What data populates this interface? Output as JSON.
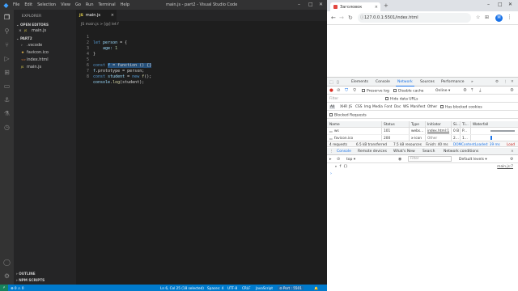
{
  "vscode": {
    "menu": [
      "File",
      "Edit",
      "Selection",
      "View",
      "Go",
      "Run",
      "Terminal",
      "Help"
    ],
    "window_title": "main.js - part2 - Visual Studio Code",
    "sidebar": {
      "title": "EXPLORER",
      "open_editors_label": "OPEN EDITORS",
      "open_editors": [
        {
          "close": "×",
          "icon": "JS",
          "name": "main.js"
        }
      ],
      "folder_label": "PART2",
      "files": [
        {
          "icon": "›",
          "name": ".vscode"
        },
        {
          "icon": "★",
          "name": "favicon.ico"
        },
        {
          "icon": "<>",
          "name": "index.html"
        },
        {
          "icon": "JS",
          "name": "main.js"
        }
      ],
      "outline_label": "OUTLINE",
      "npm_label": "NPM SCRIPTS"
    },
    "tab": {
      "icon": "JS",
      "name": "main.js",
      "close": "×"
    },
    "breadcrumb": "JS main.js > [@] let f",
    "code": {
      "numbers": [
        "1",
        "2",
        "3",
        "4",
        "5",
        "6",
        "7",
        "8"
      ],
      "l1": {
        "kw": "let ",
        "var": "person",
        "rest": " = {"
      },
      "l2": {
        "text": "    age: ",
        "num": "1"
      },
      "l3": {
        "text": "}"
      },
      "l5": {
        "kw": "const ",
        "var": "f",
        "sel": " = function () {}",
        "rest": ""
      },
      "l6": {
        "var": "f",
        "rest": ".prototype = person;"
      },
      "l7": {
        "kw": "const ",
        "var": "student",
        "mid": " = ",
        "kw2": "new ",
        "fn": "f",
        "rest": "();"
      },
      "l8": {
        "var": "console",
        "dot": ".",
        "fn": "log",
        "rest": "(student);"
      }
    },
    "status": {
      "remote": "⚡",
      "errors": "⊗ 0 ⚠ 0",
      "position": "Ln 6, Col 25 (18 selected)",
      "spaces": "Spaces: 4",
      "encoding": "UTF-8",
      "eol": "CRLF",
      "language": "JavaScript",
      "port": "⊘ Port : 5501",
      "bell": "🔔"
    },
    "colors": {
      "accent": "#007acc",
      "bg": "#1e1e1e",
      "sidebar": "#252526"
    }
  },
  "browser": {
    "tab_title": "Заголовок",
    "tab_close": "×",
    "new_tab": "+",
    "url": "127.0.0.1:5501/index.html",
    "avatar_letter": "M",
    "devtools": {
      "tabs": [
        "Elements",
        "Console",
        "Network",
        "Sources",
        "Performance"
      ],
      "active_tab": "Network",
      "more": "»",
      "toolbar": {
        "preserve_log": "Preserve log",
        "disable_cache": "Disable cache",
        "throttle": "Online"
      },
      "filter_placeholder": "Filter",
      "hide_data_urls": "Hide data URLs",
      "types": [
        "All",
        "XHR",
        "JS",
        "CSS",
        "Img",
        "Media",
        "Font",
        "Doc",
        "WS",
        "Manifest",
        "Other"
      ],
      "has_blocked_cookies": "Has blocked cookies",
      "blocked_requests": "Blocked Requests",
      "table": {
        "headers": [
          "Name",
          "Status",
          "Type",
          "Initiator",
          "Si...",
          "Ti...",
          "Waterfall"
        ],
        "rows": [
          {
            "name": "ws",
            "status": "101",
            "type": "webs...",
            "initiator": "index.html:1",
            "size": "0 B",
            "time": "P..."
          },
          {
            "name": "favicon.ico",
            "status": "200",
            "type": "x-icon",
            "initiator": "Other",
            "size": "2...",
            "time": "1..."
          }
        ]
      },
      "summary": {
        "requests": "4 requests",
        "transferred": "6.5 kB transferred",
        "resources": "7.5 kB resources",
        "finish": "Finish: 40 ms",
        "dcl": "DOMContentLoaded: 39 ms",
        "load": "Load"
      },
      "drawer_tabs": [
        "Console",
        "Remote devices",
        "What's New",
        "Search",
        "Network conditions"
      ],
      "drawer_close": "×",
      "console_context": "top",
      "console_filter": "Filter",
      "console_levels": "Default levels ▾",
      "console_output": "▸ f {}",
      "console_source": "main.js:7"
    }
  }
}
